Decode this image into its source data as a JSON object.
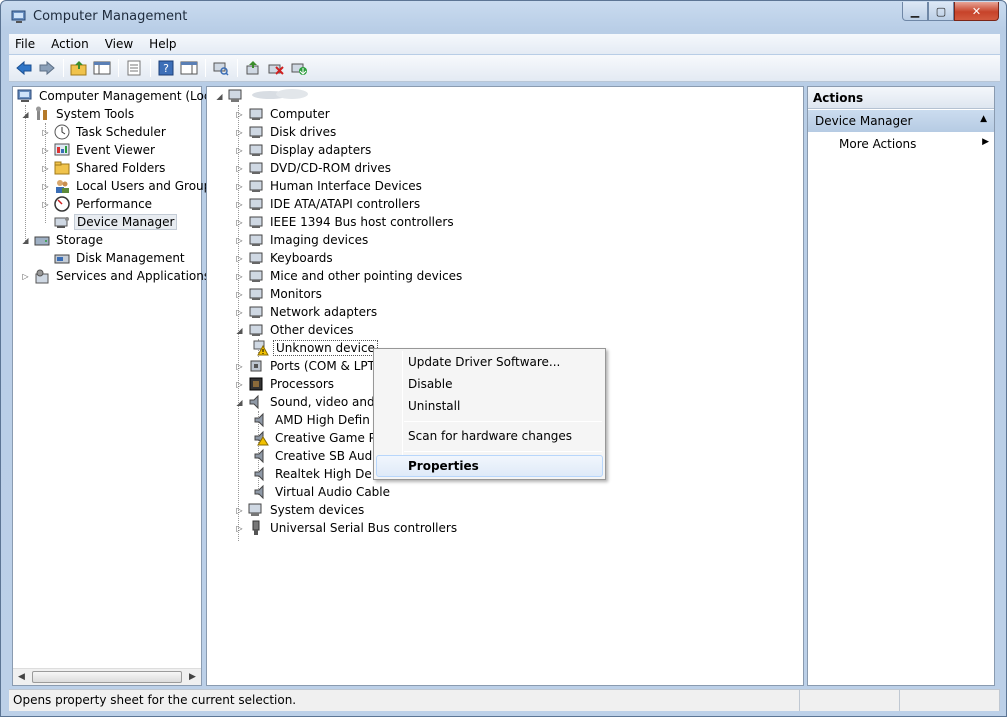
{
  "window": {
    "title": "Computer Management"
  },
  "menu": [
    "File",
    "Action",
    "View",
    "Help"
  ],
  "left_tree": {
    "root": "Computer Management (Local",
    "system_tools": "System Tools",
    "task_scheduler": "Task Scheduler",
    "event_viewer": "Event Viewer",
    "shared_folders": "Shared Folders",
    "local_users": "Local Users and Groups",
    "performance": "Performance",
    "device_manager": "Device Manager",
    "storage": "Storage",
    "disk_management": "Disk Management",
    "services": "Services and Applications"
  },
  "device_tree": {
    "categories": [
      "Computer",
      "Disk drives",
      "Display adapters",
      "DVD/CD-ROM drives",
      "Human Interface Devices",
      "IDE ATA/ATAPI controllers",
      "IEEE 1394 Bus host controllers",
      "Imaging devices",
      "Keyboards",
      "Mice and other pointing devices",
      "Monitors",
      "Network adapters",
      "Other devices"
    ],
    "unknown_device": "Unknown device",
    "ports": "Ports (COM & LPT)",
    "processors": "Processors",
    "sound": "Sound, video and ga",
    "sound_children": [
      "AMD High Defin",
      "Creative Game P",
      "Creative SB Aud",
      "Realtek High De",
      "Virtual Audio Cable"
    ],
    "tail": [
      "System devices",
      "Universal Serial Bus controllers"
    ]
  },
  "actions": {
    "header": "Actions",
    "section": "Device Manager",
    "more": "More Actions"
  },
  "context_menu": {
    "update": "Update Driver Software...",
    "disable": "Disable",
    "uninstall": "Uninstall",
    "scan": "Scan for hardware changes",
    "properties": "Properties"
  },
  "status": "Opens property sheet for the current selection.",
  "icons": {
    "back": "back-arrow-icon",
    "forward": "forward-arrow-icon",
    "warning": "warning-icon"
  },
  "colors": {
    "accent": "#3a6db5",
    "warning": "#f2c200",
    "close": "#c7432a"
  }
}
